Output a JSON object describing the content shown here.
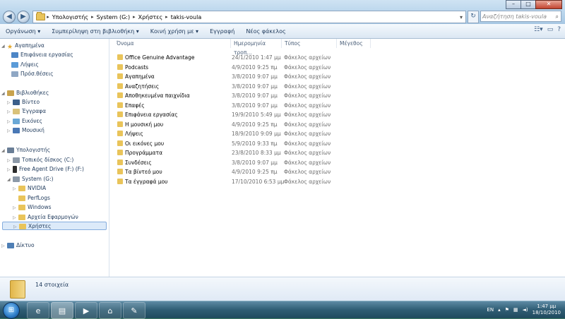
{
  "address": {
    "crumbs": [
      "Υπολογιστής",
      "System (G:)",
      "Χρήστες",
      "takis-voula"
    ],
    "search_placeholder": "Αναζήτηση takis-voula"
  },
  "window_buttons": {
    "minimize": "–",
    "maximize": "□",
    "close": "✕"
  },
  "toolbar": {
    "organize": "Οργάνωση ▾",
    "include_library": "Συμπερίληψη στη βιβλιοθήκη ▾",
    "share_with": "Κοινή χρήση με ▾",
    "burn": "Εγγραφή",
    "new_folder": "Νέος φάκελος"
  },
  "nav": {
    "favorites": "Αγαπημένα",
    "desktop": "Επιφάνεια εργασίας",
    "downloads": "Λήψεις",
    "recent": "Πρόσ.θέσεις",
    "libraries": "Βιβλιοθήκες",
    "videos": "Βίντεο",
    "documents": "Έγγραφα",
    "pictures": "Εικόνες",
    "music": "Μουσική",
    "computer": "Υπολογιστής",
    "local_disk": "Τοπικός δίσκος (C:)",
    "free_agent": "Free Agent Drive (F:) (F:)",
    "system": "System (G:)",
    "nvidia": "NVIDIA",
    "perflogs": "PerfLogs",
    "windows": "Windows",
    "program_files": "Αρχεία Εφαρμογών",
    "users": "Χρήστες",
    "network": "Δίκτυο"
  },
  "columns": {
    "name": "Όνομα",
    "date": "Ημερομηνία τροπ...",
    "type": "Τύπος",
    "size": "Μέγεθος"
  },
  "files": [
    {
      "name": "Office Genuine Advantage",
      "date": "24/1/2010 1:47 μμ",
      "type": "Φάκελος αρχείων"
    },
    {
      "name": "Podcasts",
      "date": "4/9/2010 9:25 πμ",
      "type": "Φάκελος αρχείων"
    },
    {
      "name": "Αγαπημένα",
      "date": "3/8/2010 9:07 μμ",
      "type": "Φάκελος αρχείων"
    },
    {
      "name": "Αναζητήσεις",
      "date": "3/8/2010 9:07 μμ",
      "type": "Φάκελος αρχείων"
    },
    {
      "name": "Αποθηκευμένα παιχνίδια",
      "date": "3/8/2010 9:07 μμ",
      "type": "Φάκελος αρχείων"
    },
    {
      "name": "Επαφές",
      "date": "3/8/2010 9:07 μμ",
      "type": "Φάκελος αρχείων"
    },
    {
      "name": "Επιφάνεια εργασίας",
      "date": "19/9/2010 5:49 μμ",
      "type": "Φάκελος αρχείων"
    },
    {
      "name": "Η μουσική μου",
      "date": "4/9/2010 9:25 πμ",
      "type": "Φάκελος αρχείων"
    },
    {
      "name": "Λήψεις",
      "date": "18/9/2010 9:09 μμ",
      "type": "Φάκελος αρχείων"
    },
    {
      "name": "Οι εικόνες μου",
      "date": "5/9/2010 9:33 πμ",
      "type": "Φάκελος αρχείων"
    },
    {
      "name": "Προγράμματα",
      "date": "23/8/2010 8:33 μμ",
      "type": "Φάκελος αρχείων"
    },
    {
      "name": "Συνδέσεις",
      "date": "3/8/2010 9:07 μμ",
      "type": "Φάκελος αρχείων"
    },
    {
      "name": "Τα βίντεό μου",
      "date": "4/9/2010 9:25 πμ",
      "type": "Φάκελος αρχείων"
    },
    {
      "name": "Τα έγγραφά μου",
      "date": "17/10/2010 6:53 μμ",
      "type": "Φάκελος αρχείων"
    }
  ],
  "details": {
    "count": "14 στοιχεία"
  },
  "taskbar": {
    "lang": "EN",
    "time": "1:47 μμ",
    "date": "18/10/2010"
  },
  "colors": {
    "folder": "#e9c45a",
    "selection": "#dceaf9",
    "accent": "#1e395b"
  }
}
